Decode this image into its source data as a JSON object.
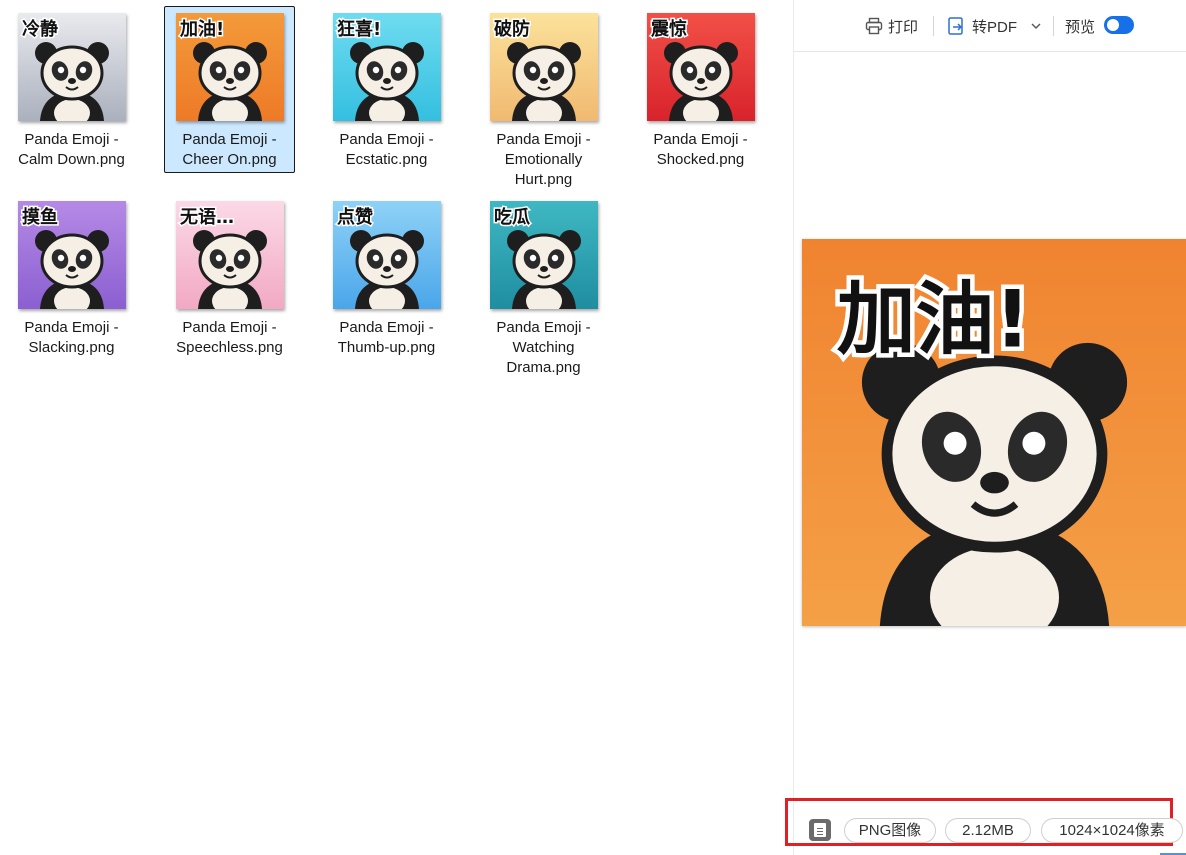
{
  "files": [
    {
      "name_lines": [
        "Panda Emoji -",
        "Calm Down.png"
      ],
      "thumb_text": "冷静",
      "bg": [
        "#e9eaee",
        "#aab0bd"
      ],
      "selected": false
    },
    {
      "name_lines": [
        "Panda Emoji -",
        "Cheer On.png"
      ],
      "thumb_text": "加油!",
      "bg": [
        "#f39a3a",
        "#ee7a27"
      ],
      "selected": true
    },
    {
      "name_lines": [
        "Panda Emoji -",
        "Ecstatic.png"
      ],
      "thumb_text": "狂喜!",
      "bg": [
        "#6fdcf0",
        "#34bfe0"
      ],
      "selected": false
    },
    {
      "name_lines": [
        "Panda Emoji -",
        "Emotionally",
        "Hurt.png"
      ],
      "thumb_text": "破防",
      "bg": [
        "#fbe29b",
        "#f1b971"
      ],
      "selected": false
    },
    {
      "name_lines": [
        "Panda Emoji -",
        "Shocked.png"
      ],
      "thumb_text": "震惊",
      "bg": [
        "#f25047",
        "#d8232c"
      ],
      "selected": false
    },
    {
      "name_lines": [
        "Panda Emoji -",
        "Slacking.png"
      ],
      "thumb_text": "摸鱼",
      "bg": [
        "#b58ae6",
        "#8b5fd0"
      ],
      "selected": false
    },
    {
      "name_lines": [
        "Panda Emoji -",
        "Speechless.png"
      ],
      "thumb_text": "无语…",
      "bg": [
        "#fbd9e6",
        "#f2a9c4"
      ],
      "selected": false
    },
    {
      "name_lines": [
        "Panda Emoji -",
        "Thumb-up.png"
      ],
      "thumb_text": "点赞",
      "bg": [
        "#8fd2f7",
        "#4aa6ea"
      ],
      "selected": false
    },
    {
      "name_lines": [
        "Panda Emoji -",
        "Watching",
        "Drama.png"
      ],
      "thumb_text": "吃瓜",
      "bg": [
        "#3fb8c3",
        "#1f8ea0"
      ],
      "selected": false
    }
  ],
  "toolbar": {
    "print_label": "打印",
    "to_pdf_label": "转PDF",
    "preview_label": "预览",
    "preview_on": true
  },
  "preview": {
    "image_text": "加油!",
    "bg": [
      "#f08330",
      "#f4a047"
    ]
  },
  "status": {
    "type": "PNG图像",
    "size": "2.12MB",
    "dimensions": "1024×1024像素"
  },
  "colors": {
    "selection": "#cce8ff",
    "accent": "#1671e8",
    "highlight_box": "#e01f26"
  }
}
